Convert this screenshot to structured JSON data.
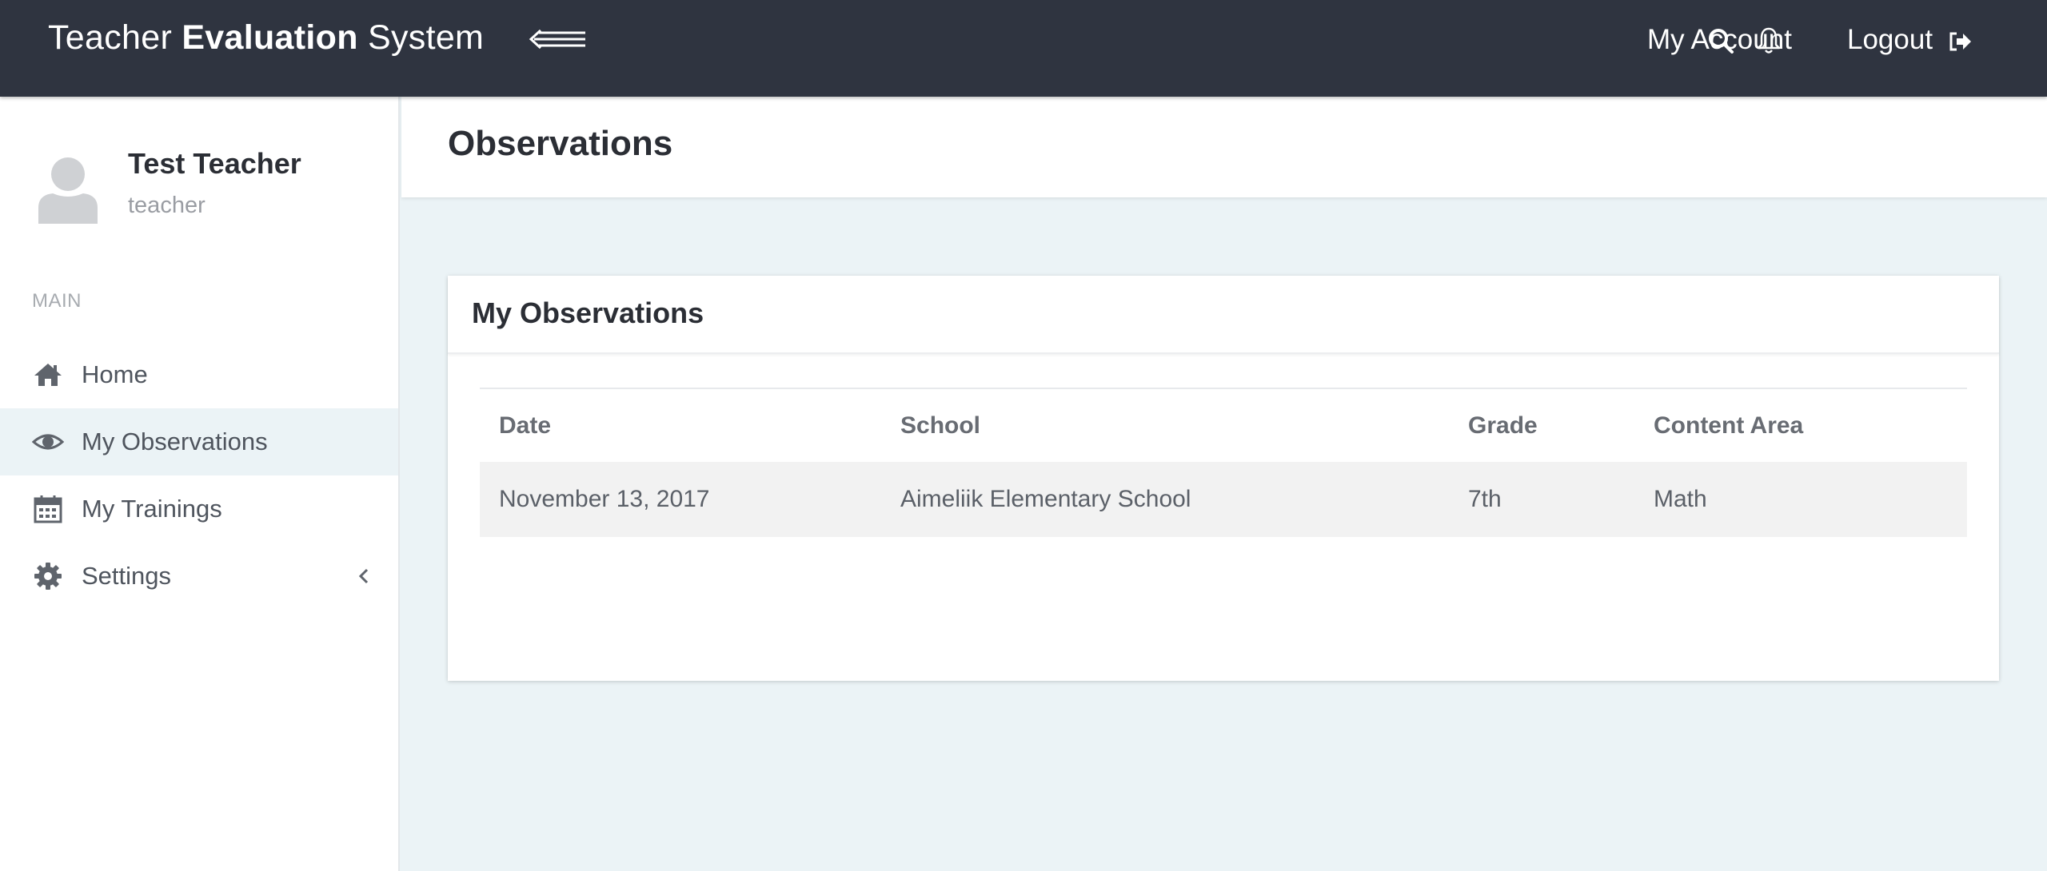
{
  "brand": {
    "part1": "Teacher",
    "part2": "Evaluation",
    "part3": "System"
  },
  "topbar": {
    "account_label": "My Account",
    "logout_label": "Logout"
  },
  "user": {
    "name": "Test Teacher",
    "role": "teacher"
  },
  "sidebar": {
    "section_label": "MAIN",
    "items": [
      {
        "label": "Home",
        "icon": "home-icon"
      },
      {
        "label": "My Observations",
        "icon": "eye-icon",
        "active": true
      },
      {
        "label": "My Trainings",
        "icon": "calendar-icon"
      },
      {
        "label": "Settings",
        "icon": "gear-icon"
      }
    ]
  },
  "page": {
    "title": "Observations"
  },
  "card": {
    "title": "My Observations",
    "columns": [
      "Date",
      "School",
      "Grade",
      "Content Area"
    ],
    "rows": [
      [
        "November 13, 2017",
        "Aimeliik Elementary School",
        "7th",
        "Math"
      ]
    ]
  },
  "colors": {
    "topbar": "#2f3440",
    "background": "#ebf3f6",
    "active_item": "#ebf3f6"
  }
}
